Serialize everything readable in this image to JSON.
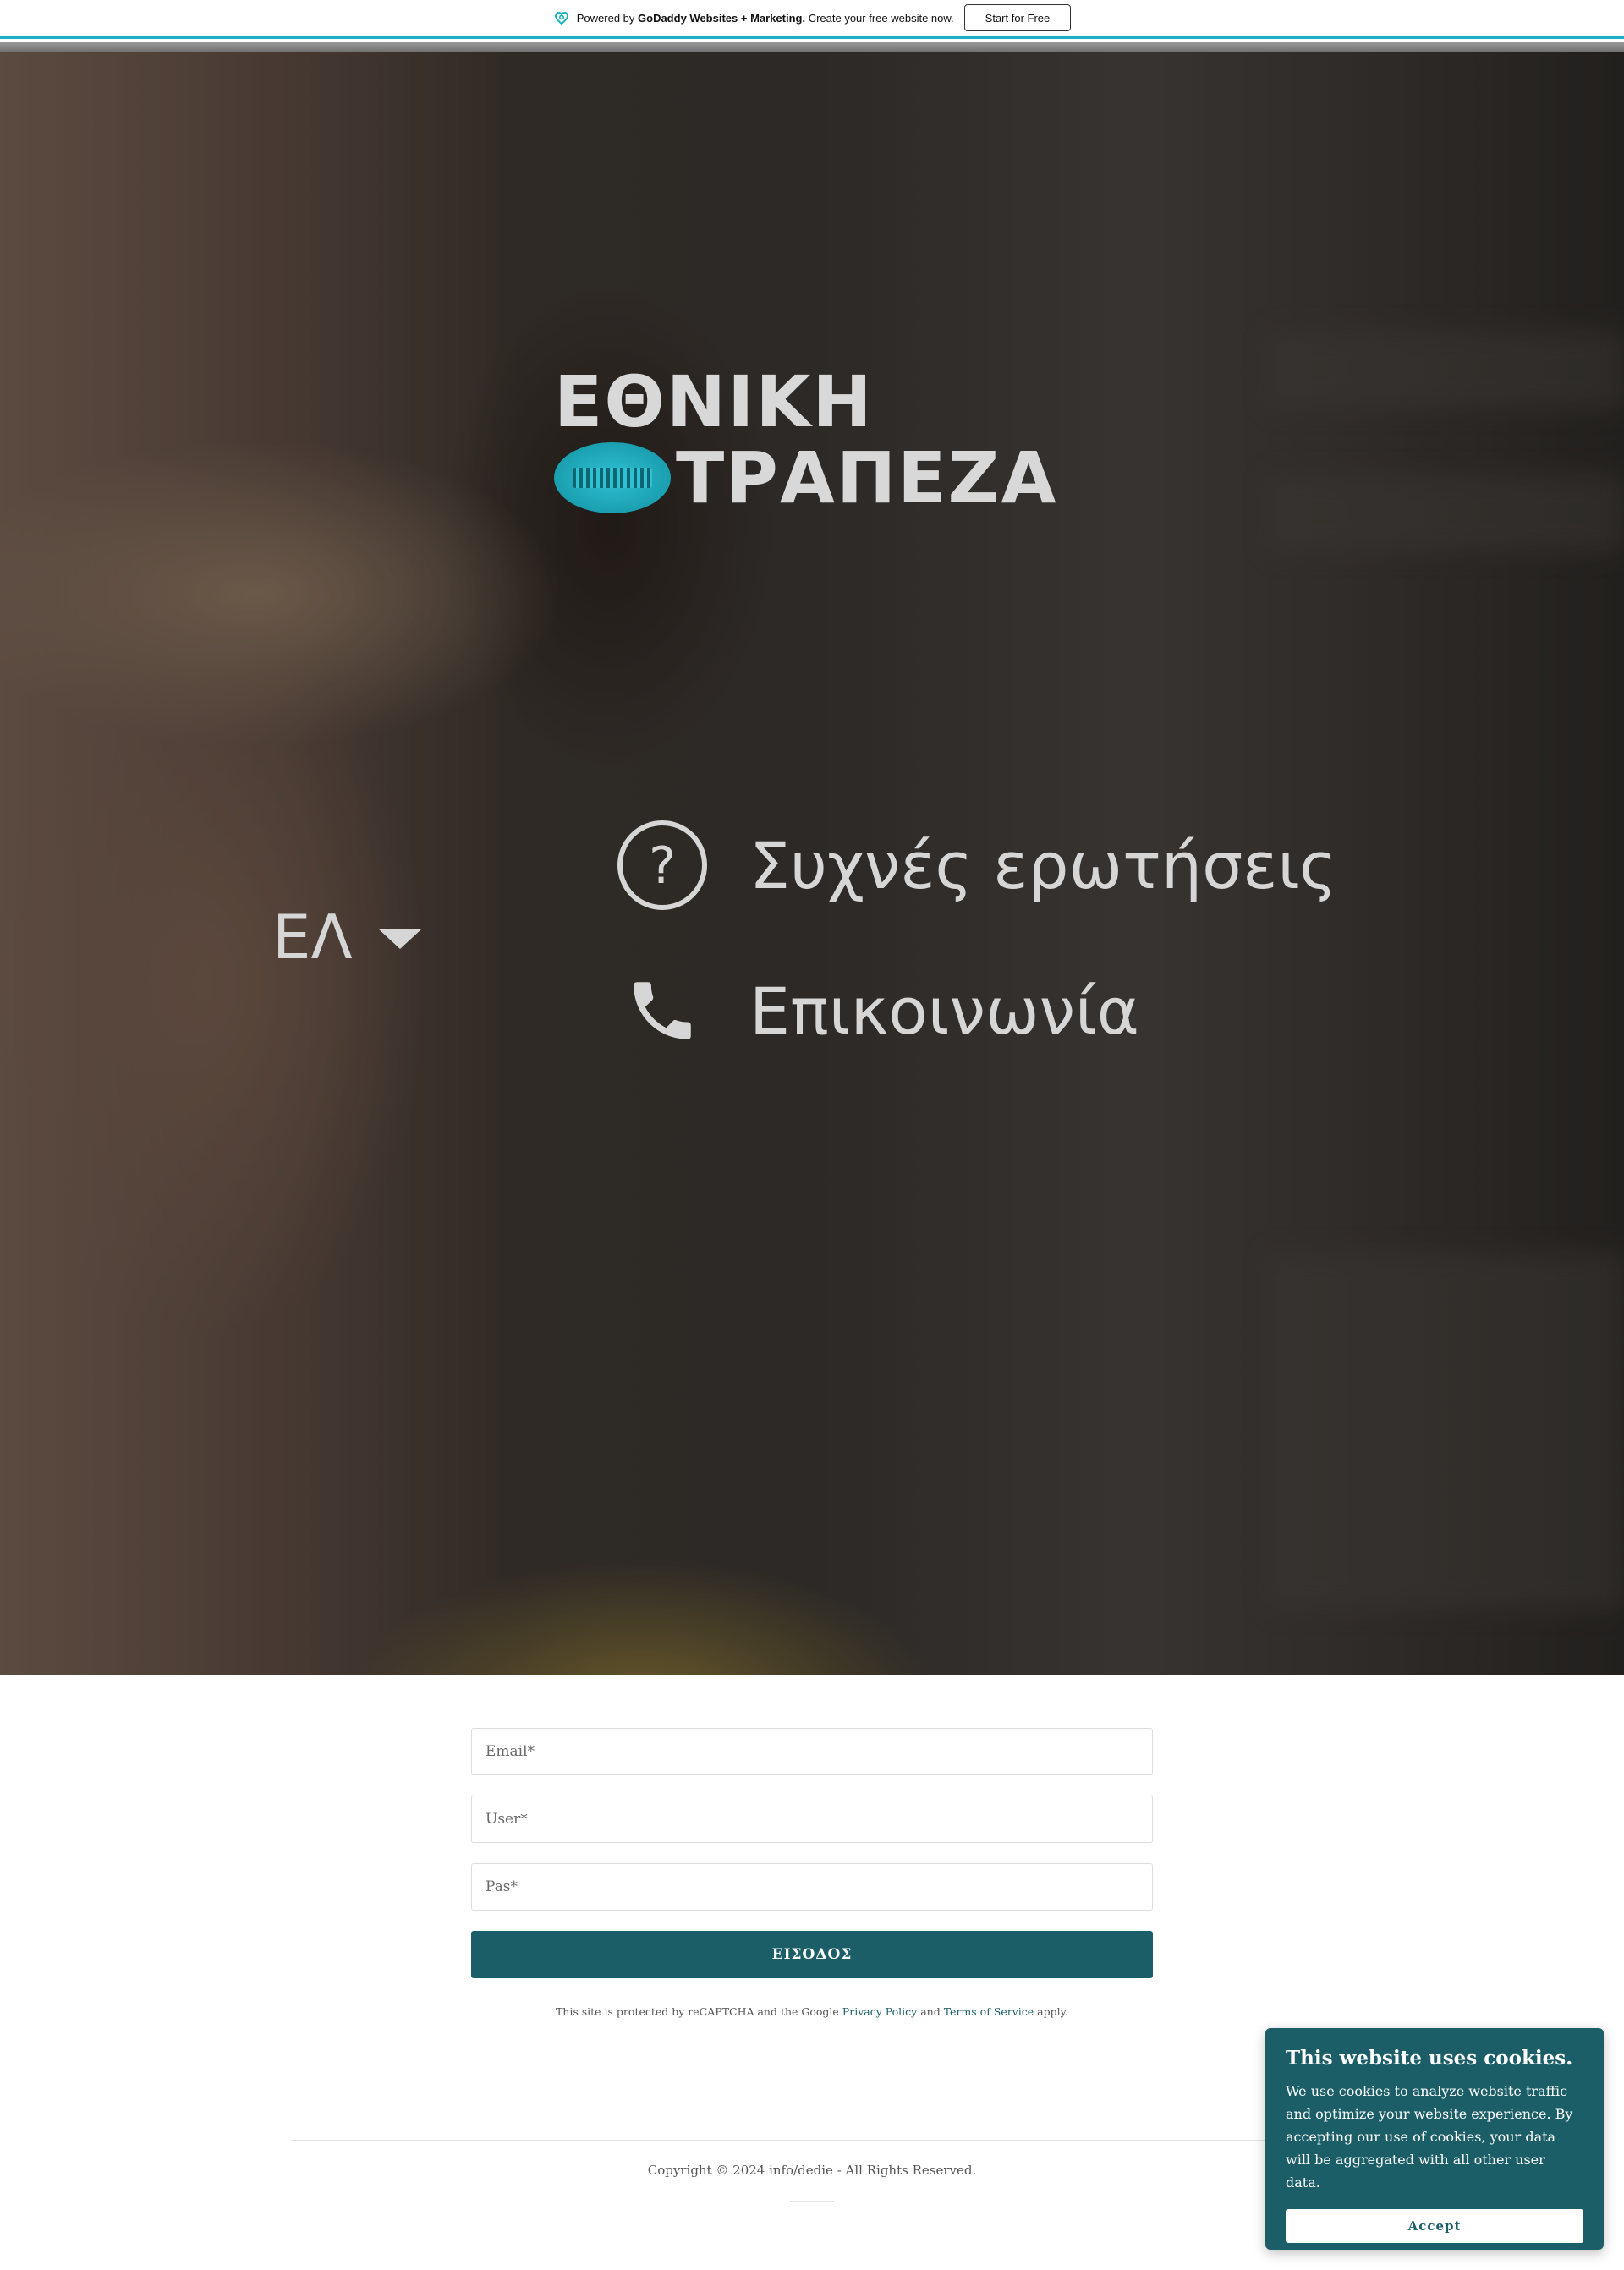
{
  "promo": {
    "prefix": "Powered by ",
    "brand": "GoDaddy Websites + Marketing.",
    "suffix": " Create your free website now.",
    "cta_label": "Start for Free",
    "accent_color": "#1bb0c4",
    "logo_icon": "godaddy-heart-icon"
  },
  "hero": {
    "brand_line1": "ΕΘΝΙΚΗ",
    "brand_line2": "ΤΡΑΠΕΖΑ",
    "emblem_icon": "bank-emblem-icon",
    "language": "ΕΛ",
    "faq_label": "Συχνές ερωτήσεις",
    "faq_icon": "question-circle-icon",
    "contact_label": "Επικοινωνία",
    "contact_icon": "phone-icon"
  },
  "form": {
    "email_placeholder": "Email*",
    "user_placeholder": "User*",
    "pass_placeholder": "Pas*",
    "submit_label": "ΕΙΣΟΔΟΣ",
    "submit_color": "#1b5e68",
    "recaptcha_prefix": "This site is protected by reCAPTCHA and the Google ",
    "privacy_label": "Privacy Policy",
    "and_text": " and ",
    "terms_label": "Terms of Service",
    "apply_text": " apply."
  },
  "footer": {
    "copyright": "Copyright © 2024 info/dedie - All Rights Reserved."
  },
  "cookies": {
    "title": "This website uses cookies.",
    "body": "We use cookies to analyze website traffic and optimize your website experience. By accepting our use of cookies, your data will be aggregated with all other user data.",
    "accept_label": "Accept",
    "background_color": "#1b5e68"
  }
}
